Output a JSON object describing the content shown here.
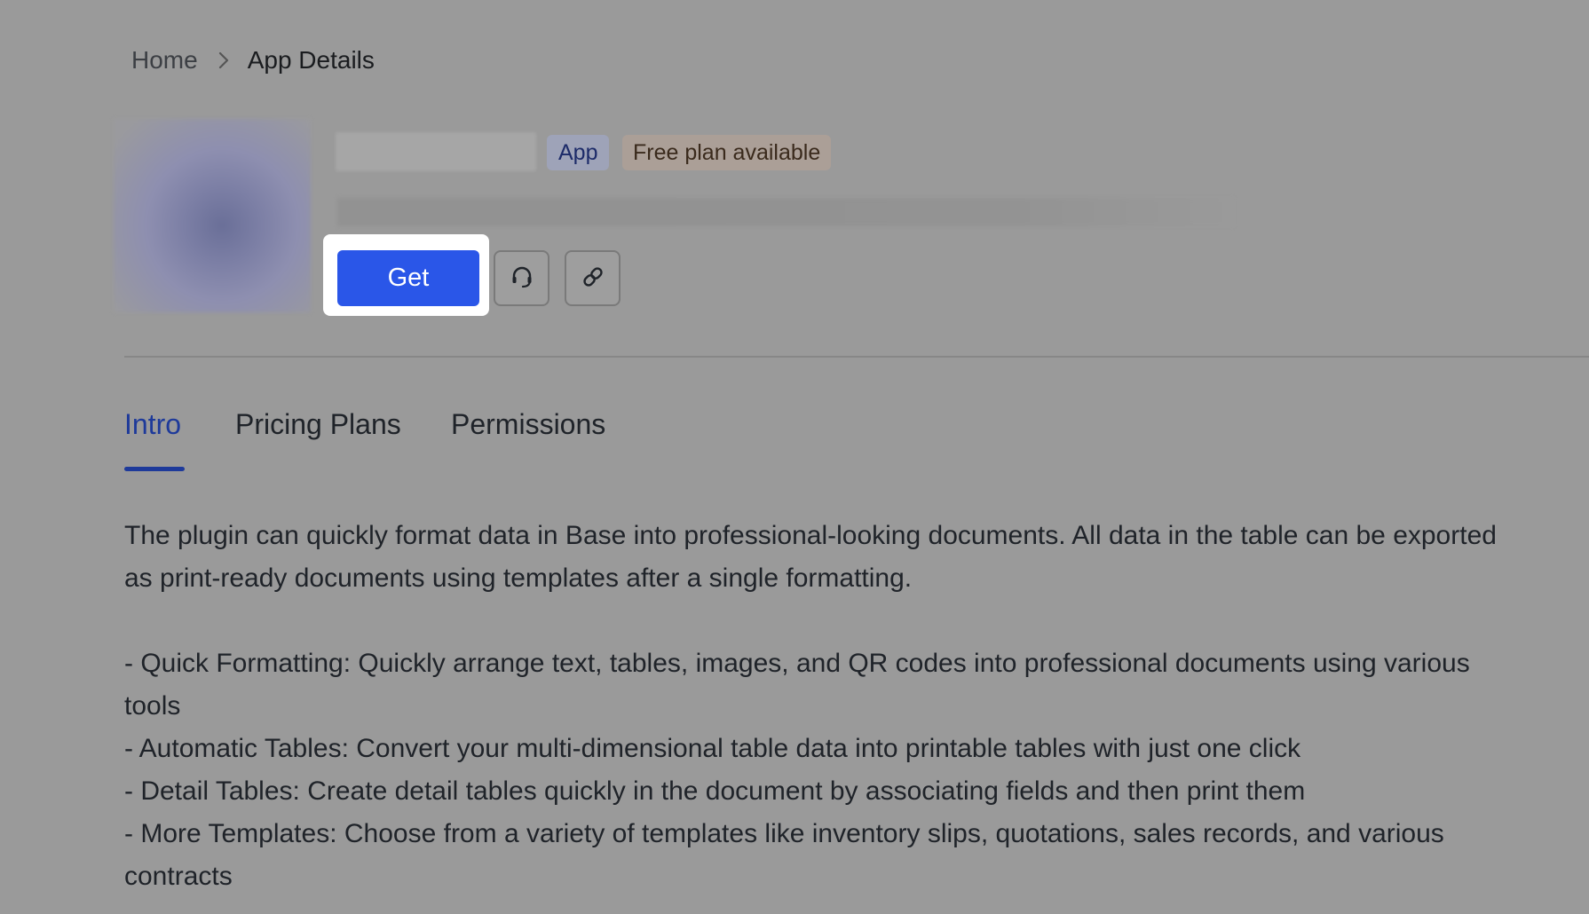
{
  "breadcrumb": {
    "home": "Home",
    "current": "App Details"
  },
  "app": {
    "badges": {
      "type": "App",
      "plan": "Free plan available"
    }
  },
  "actions": {
    "get_label": "Get"
  },
  "tabs": [
    {
      "label": "Intro",
      "active": true
    },
    {
      "label": "Pricing Plans",
      "active": false
    },
    {
      "label": "Permissions",
      "active": false
    }
  ],
  "intro": {
    "paragraph": "The plugin can quickly format data in Base into professional-looking documents. All data in the table can be exported as print-ready documents using templates after a single formatting.",
    "features": [
      "- Quick Formatting: Quickly arrange text, tables, images, and QR codes into professional documents using various tools",
      "- Automatic Tables: Convert your multi-dimensional table data into printable tables with just one click",
      "- Detail Tables: Create detail tables quickly in the document by associating fields and then print them",
      "- More Templates: Choose from a variety of templates like inventory slips, quotations, sales records, and various contracts"
    ]
  },
  "colors": {
    "accent": "#2a56e8",
    "active_tab": "#1e3a9a",
    "overlay": "#9a9a9a"
  },
  "icons": {
    "breadcrumb_separator": "chevron-right-icon",
    "support": "headset-icon",
    "share": "link-icon"
  }
}
